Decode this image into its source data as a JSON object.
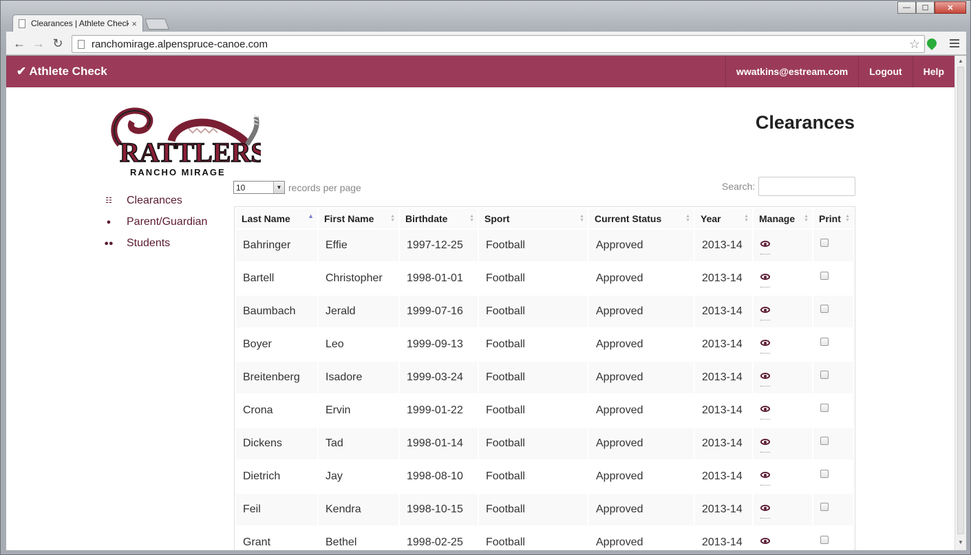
{
  "browser": {
    "tab_title": "Clearances | Athlete Check",
    "tab_close": "×",
    "url": "ranchomirage.alpenspruce-canoe.com",
    "back": "←",
    "forward": "→",
    "reload": "↻",
    "star": "☆",
    "win_min": "—",
    "win_max": "☐",
    "win_close": "✕"
  },
  "navbar": {
    "brand": "✔ Athlete Check",
    "user": "wwatkins@estream.com",
    "logout": "Logout",
    "help": "Help",
    "color": "#9b3b59"
  },
  "logo": {
    "text_main": "RATTLERS",
    "text_sub": "RANCHO MIRAGE"
  },
  "page": {
    "title": "Clearances"
  },
  "sidebar": {
    "items": [
      {
        "label": "Clearances",
        "icon": "list-icon"
      },
      {
        "label": "Parent/Guardian",
        "icon": "user-icon"
      },
      {
        "label": "Students",
        "icon": "group-icon"
      }
    ]
  },
  "table_controls": {
    "length_value": "10",
    "length_suffix": "records per page",
    "search_label": "Search:"
  },
  "table": {
    "columns": [
      "Last Name",
      "First Name",
      "Birthdate",
      "Sport",
      "Current Status",
      "Year",
      "Manage",
      "Print"
    ],
    "rows": [
      [
        "Bahringer",
        "Effie",
        "1997-12-25",
        "Football",
        "Approved",
        "2013-14"
      ],
      [
        "Bartell",
        "Christopher",
        "1998-01-01",
        "Football",
        "Approved",
        "2013-14"
      ],
      [
        "Baumbach",
        "Jerald",
        "1999-07-16",
        "Football",
        "Approved",
        "2013-14"
      ],
      [
        "Boyer",
        "Leo",
        "1999-09-13",
        "Football",
        "Approved",
        "2013-14"
      ],
      [
        "Breitenberg",
        "Isadore",
        "1999-03-24",
        "Football",
        "Approved",
        "2013-14"
      ],
      [
        "Crona",
        "Ervin",
        "1999-01-22",
        "Football",
        "Approved",
        "2013-14"
      ],
      [
        "Dickens",
        "Tad",
        "1998-01-14",
        "Football",
        "Approved",
        "2013-14"
      ],
      [
        "Dietrich",
        "Jay",
        "1998-08-10",
        "Football",
        "Approved",
        "2013-14"
      ],
      [
        "Feil",
        "Kendra",
        "1998-10-15",
        "Football",
        "Approved",
        "2013-14"
      ],
      [
        "Grant",
        "Bethel",
        "1998-02-25",
        "Football",
        "Approved",
        "2013-14"
      ]
    ]
  }
}
